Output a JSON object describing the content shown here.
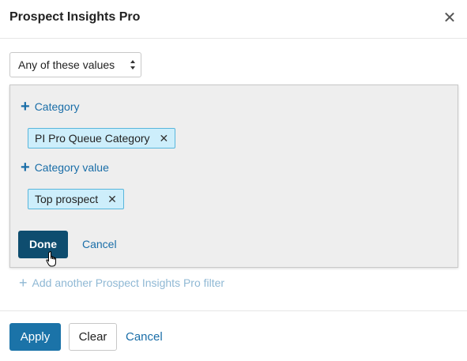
{
  "dialog": {
    "title": "Prospect Insights Pro",
    "close_icon": "close-icon"
  },
  "operator_select": {
    "selected": "Any of these values"
  },
  "panel": {
    "add_category_label": "Category",
    "category_chip": "PI Pro Queue Category",
    "add_value_label": "Category value",
    "value_chip": "Top prospect",
    "done_label": "Done",
    "cancel_label": "Cancel"
  },
  "add_filter_label": "Add another Prospect Insights Pro filter",
  "footer": {
    "apply_label": "Apply",
    "clear_label": "Clear",
    "cancel_label": "Cancel"
  },
  "colors": {
    "primary": "#1b73a8",
    "done_button": "#0e4d6f",
    "link": "#1a6ea8",
    "chip_bg": "#cdeefb",
    "chip_border": "#58b6dc",
    "panel_bg": "#eeeeee"
  }
}
